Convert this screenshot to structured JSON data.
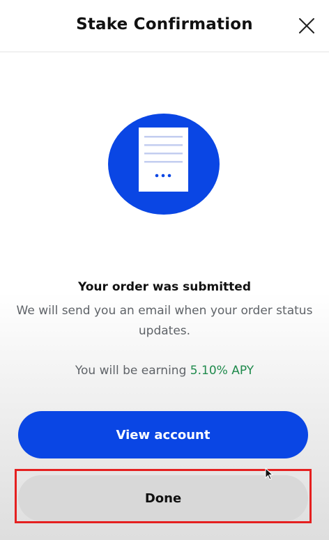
{
  "header": {
    "title": "Stake Confirmation",
    "close_icon": "close-icon"
  },
  "illustration": {
    "icon": "document-pending-icon",
    "circle_color": "#0a46e4"
  },
  "message": {
    "title": "Your order was submitted",
    "description": "We will send you an email when your order status updates."
  },
  "earning": {
    "prefix": "You will be earning",
    "apy": "5.10% APY",
    "apy_color": "#1f8a4c"
  },
  "actions": {
    "view_account_label": "View account",
    "done_label": "Done",
    "primary_color": "#0a46e4",
    "highlight_color": "#e52020"
  }
}
